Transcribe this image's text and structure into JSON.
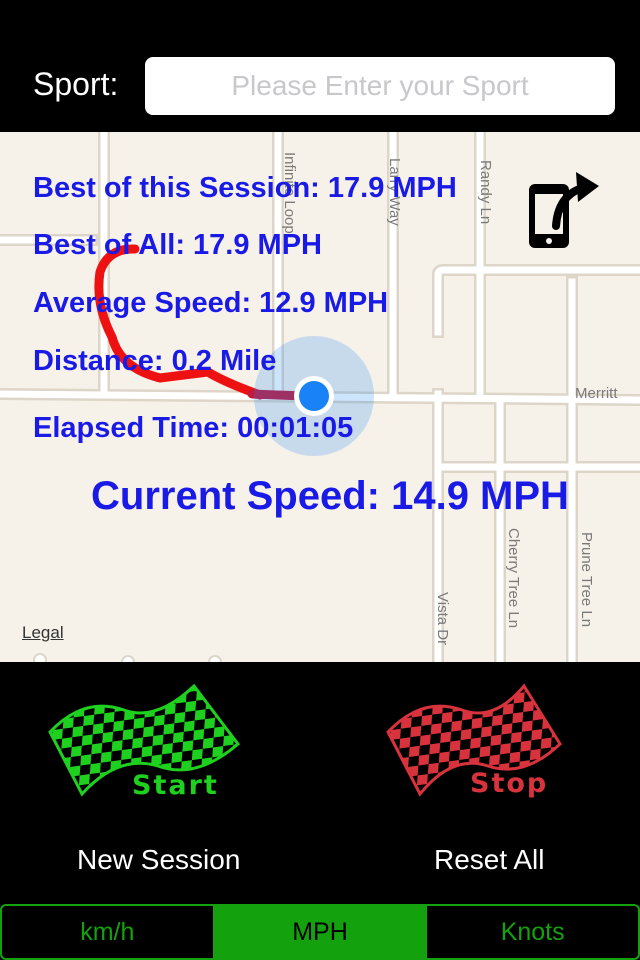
{
  "header": {
    "sport_label": "Sport:",
    "sport_placeholder": "Please Enter your Sport"
  },
  "map": {
    "streets": [
      "Infinite Loop",
      "Larry Way",
      "Randy Ln",
      "Merritt",
      "Vista Dr",
      "Cherry Tree Ln",
      "Prune Tree Ln"
    ],
    "legal": "Legal",
    "share_icon": "share-phone-icon"
  },
  "stats": {
    "best_session": "Best of this Session: 17.9 MPH",
    "best_all": "Best of All: 17.9 MPH",
    "average_speed": "Average Speed: 12.9 MPH",
    "distance": "Distance: 0.2 Mile",
    "elapsed_time": "Elapsed Time: 00:01:05",
    "current_speed": "Current Speed: 14.9 MPH"
  },
  "controls": {
    "start_label": "Start",
    "stop_label": "Stop",
    "new_session": "New Session",
    "reset_all": "Reset All"
  },
  "units": {
    "options": [
      "km/h",
      "MPH",
      "Knots"
    ],
    "selected": "MPH"
  },
  "colors": {
    "stat_text": "#1a1ae6",
    "route": "#ee1111",
    "location_dot": "#1a82f7",
    "start_flag": "#1fd11f",
    "stop_flag": "#d8333d",
    "segment_green": "#13a10e"
  }
}
